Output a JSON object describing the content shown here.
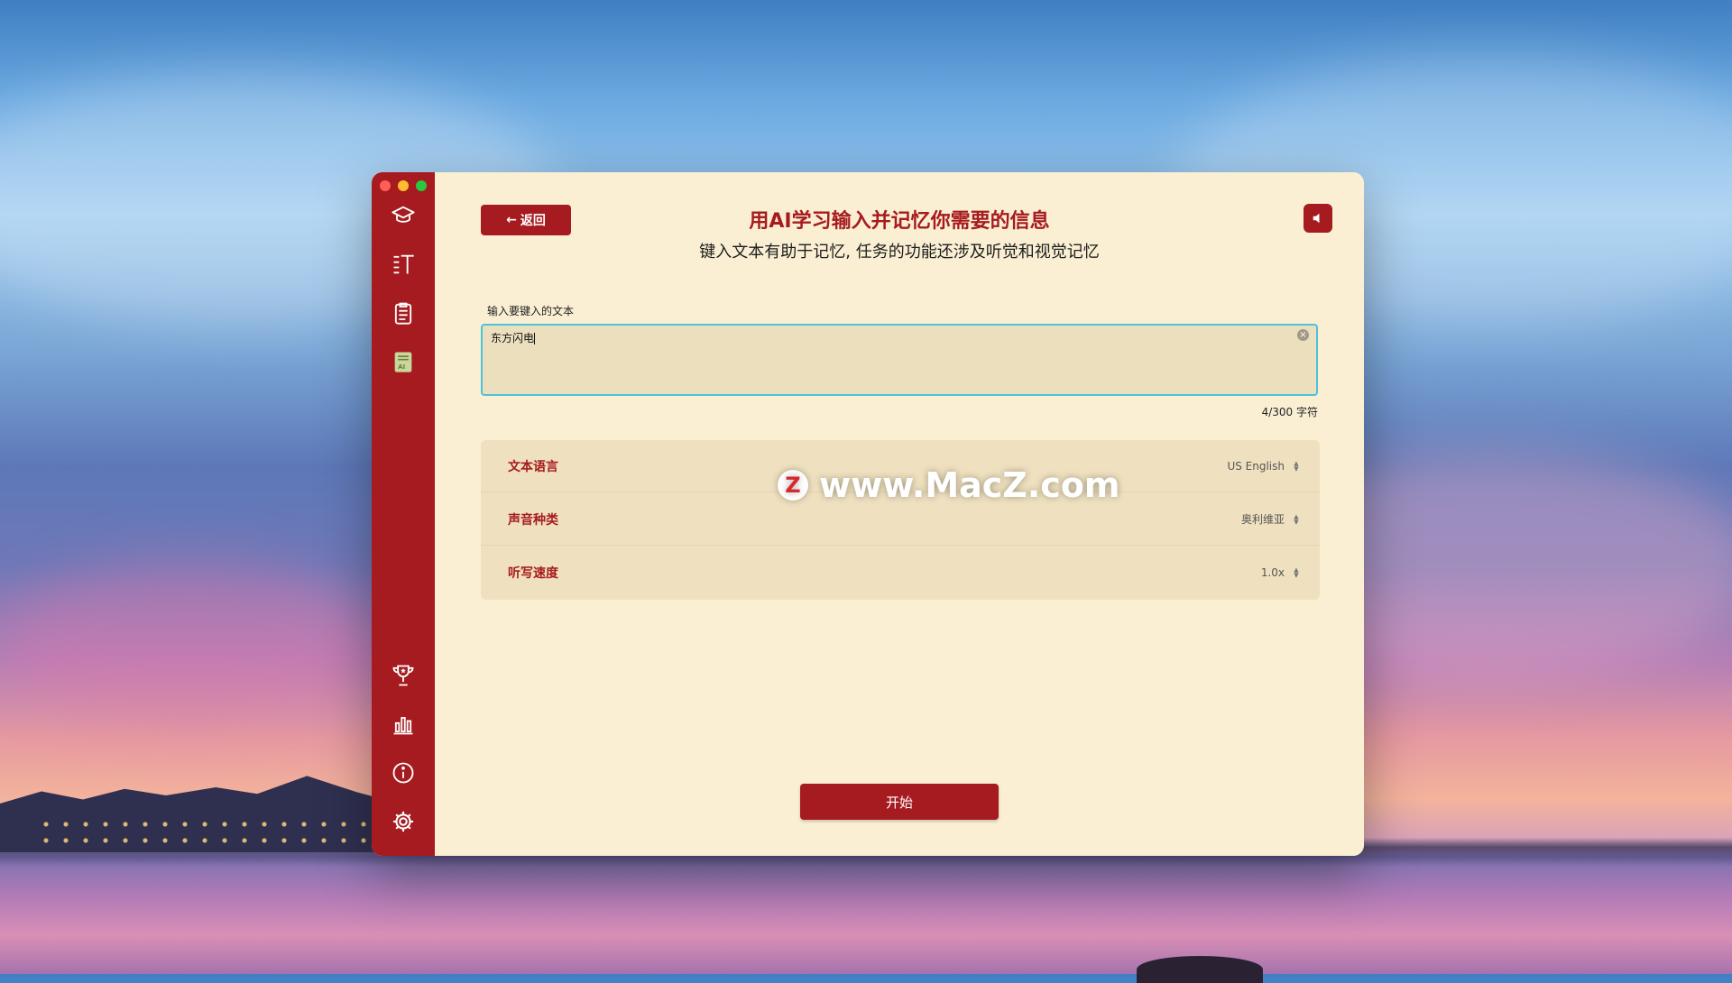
{
  "window": {
    "traffic_colors": [
      "#ff5f57",
      "#febc2e",
      "#28c840"
    ]
  },
  "sidebar": {
    "top_icons": [
      "graduation-cap-icon",
      "text-size-icon",
      "clipboard-icon",
      "ai-notebook-icon"
    ],
    "bottom_icons": [
      "trophy-icon",
      "bar-chart-icon",
      "info-icon",
      "settings-gear-icon"
    ]
  },
  "header": {
    "back_label": "返回",
    "title": "用AI学习输入并记忆你需要的信息",
    "subtitle": "键入文本有助于记忆, 任务的功能还涉及听觉和视觉记忆"
  },
  "input": {
    "label": "输入要键入的文本",
    "value": "东方闪电",
    "counter": "4/300 字符"
  },
  "settings": [
    {
      "label": "文本语言",
      "value": "US English"
    },
    {
      "label": "声音种类",
      "value": "奥利维亚"
    },
    {
      "label": "听写速度",
      "value": "1.0x"
    }
  ],
  "watermark": {
    "logo": "Z",
    "text": "www.MacZ.com"
  },
  "start_label": "开始",
  "colors": {
    "accent": "#a61b1f",
    "background": "#faefd3",
    "input_border": "#4cc3d8"
  }
}
